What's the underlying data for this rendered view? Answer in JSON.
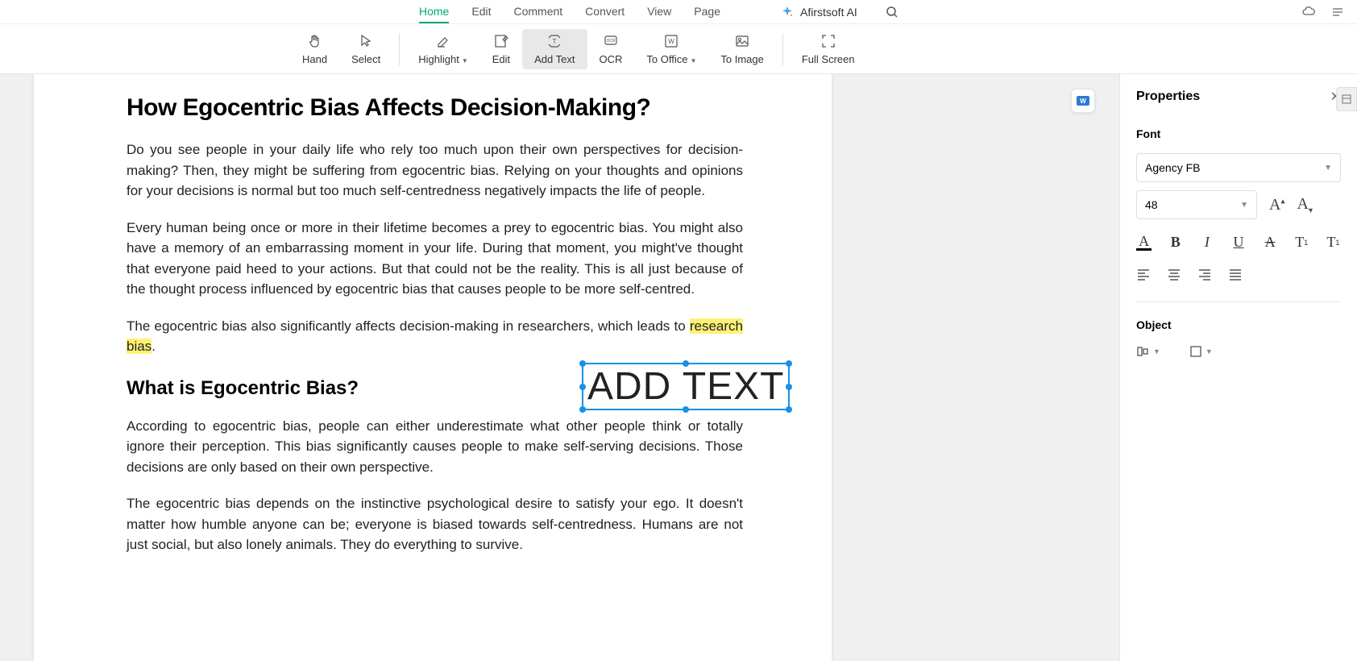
{
  "tabs": {
    "home": "Home",
    "edit": "Edit",
    "comment": "Comment",
    "convert": "Convert",
    "view": "View",
    "page": "Page"
  },
  "ai": {
    "label": "Afirstsoft AI"
  },
  "toolbar": {
    "hand": "Hand",
    "select": "Select",
    "highlight": "Highlight",
    "edit": "Edit",
    "add_text": "Add Text",
    "ocr": "OCR",
    "to_office": "To Office",
    "to_image": "To Image",
    "full_screen": "Full Screen"
  },
  "document": {
    "h1": "How Egocentric Bias Affects Decision-Making?",
    "p1": "Do you see people in your daily life who rely too much upon their own perspectives for decision-making? Then, they might be suffering from egocentric bias. Relying on your thoughts and opinions for your decisions is normal but too much self-centredness negatively impacts the life of people.",
    "p2": "Every human being once or more in their lifetime becomes a prey to egocentric bias. You might also have a memory of an embarrassing moment in your life. During that moment, you might've thought that everyone paid heed to your actions. But that could not be the reality. This is all just because of the thought process influenced by egocentric bias that causes people to be more self-centred.",
    "p3_pre": "The egocentric bias also significantly affects decision-making in researchers, which leads to ",
    "p3_highlight": "research bias",
    "p3_post": ".",
    "h2": "What is Egocentric Bias?",
    "p4": "According to egocentric bias, people can either underestimate what other people think or totally ignore their perception. This bias significantly causes people to make self-serving decisions. Those decisions are only based on their own perspective.",
    "p5": "The egocentric bias depends on the instinctive psychological desire to satisfy your ego. It doesn't matter how humble anyone can be; everyone is biased towards self-centredness. Humans are not just social, but also lonely animals. They do everything to survive.",
    "text_box": "ADD TEXT"
  },
  "properties": {
    "title": "Properties",
    "font_label": "Font",
    "font_name": "Agency FB",
    "font_size": "48",
    "object_label": "Object"
  }
}
